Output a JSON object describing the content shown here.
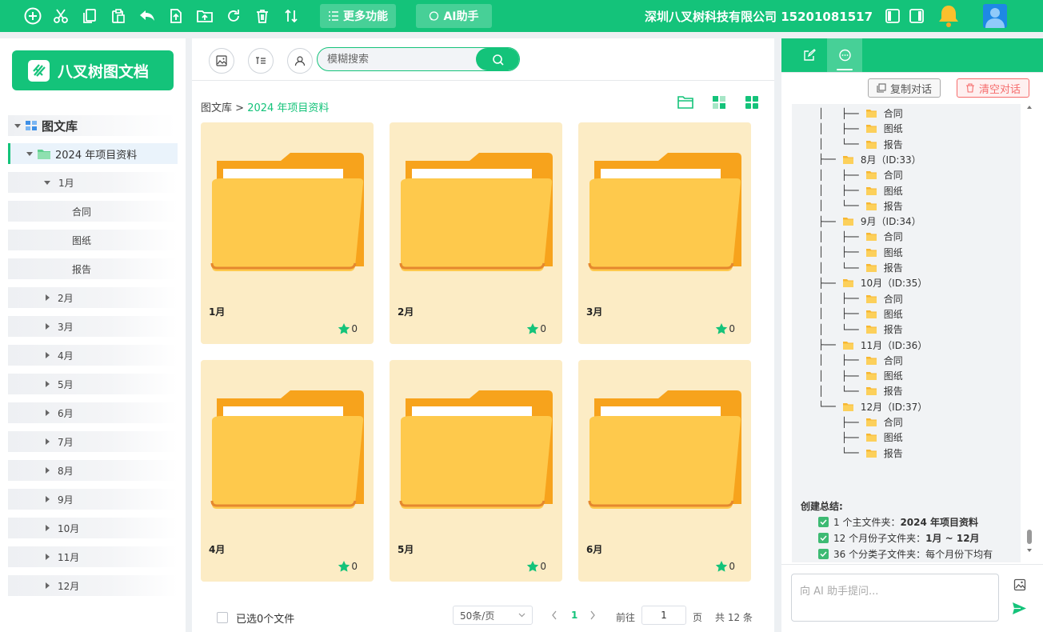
{
  "toolbar": {
    "more_label": "更多功能",
    "ai_label": "AI助手",
    "company": "深圳八叉树科技有限公司 15201081517"
  },
  "sidebar": {
    "logo_text": "八叉树图文档",
    "root_label": "图文库",
    "project_label": "2024 年项目资料",
    "expanded_month": "1月",
    "sub_items": [
      "合同",
      "图纸",
      "报告"
    ],
    "months": [
      "2月",
      "3月",
      "4月",
      "5月",
      "6月",
      "7月",
      "8月",
      "9月",
      "10月",
      "11月",
      "12月"
    ]
  },
  "main": {
    "search_placeholder": "模糊搜索",
    "breadcrumb_root": "图文库",
    "breadcrumb_sep": ">",
    "breadcrumb_current": "2024 年项目资料",
    "folders": [
      {
        "name": "1月",
        "stars": "0"
      },
      {
        "name": "2月",
        "stars": "0"
      },
      {
        "name": "3月",
        "stars": "0"
      },
      {
        "name": "4月",
        "stars": "0"
      },
      {
        "name": "5月",
        "stars": "0"
      },
      {
        "name": "6月",
        "stars": "0"
      }
    ],
    "footer": {
      "selected": "已选0个文件",
      "page_size": "50条/页",
      "current_page": "1",
      "goto_prefix": "前往",
      "goto_value": "1",
      "goto_suffix": "页",
      "total": "共 12 条"
    }
  },
  "assistant": {
    "copy_label": "复制对话",
    "clear_label": "清空对话",
    "tree_lines": [
      {
        "prefix": "│   ├── ",
        "folder": true,
        "text": "合同"
      },
      {
        "prefix": "│   ├── ",
        "folder": true,
        "text": "图纸"
      },
      {
        "prefix": "│   └── ",
        "folder": true,
        "text": "报告"
      },
      {
        "prefix": "├── ",
        "folder": true,
        "text": "8月（ID:33）"
      },
      {
        "prefix": "│   ├── ",
        "folder": true,
        "text": "合同"
      },
      {
        "prefix": "│   ├── ",
        "folder": true,
        "text": "图纸"
      },
      {
        "prefix": "│   └── ",
        "folder": true,
        "text": "报告"
      },
      {
        "prefix": "├── ",
        "folder": true,
        "text": "9月（ID:34）"
      },
      {
        "prefix": "│   ├── ",
        "folder": true,
        "text": "合同"
      },
      {
        "prefix": "│   ├── ",
        "folder": true,
        "text": "图纸"
      },
      {
        "prefix": "│   └── ",
        "folder": true,
        "text": "报告"
      },
      {
        "prefix": "├── ",
        "folder": true,
        "text": "10月（ID:35）"
      },
      {
        "prefix": "│   ├── ",
        "folder": true,
        "text": "合同"
      },
      {
        "prefix": "│   ├── ",
        "folder": true,
        "text": "图纸"
      },
      {
        "prefix": "│   └── ",
        "folder": true,
        "text": "报告"
      },
      {
        "prefix": "├── ",
        "folder": true,
        "text": "11月（ID:36）"
      },
      {
        "prefix": "│   ├── ",
        "folder": true,
        "text": "合同"
      },
      {
        "prefix": "│   ├── ",
        "folder": true,
        "text": "图纸"
      },
      {
        "prefix": "│   └── ",
        "folder": true,
        "text": "报告"
      },
      {
        "prefix": "└── ",
        "folder": true,
        "text": "12月（ID:37）"
      },
      {
        "prefix": "    ├── ",
        "folder": true,
        "text": "合同"
      },
      {
        "prefix": "    ├── ",
        "folder": true,
        "text": "图纸"
      },
      {
        "prefix": "    └── ",
        "folder": true,
        "text": "报告"
      }
    ],
    "summary_title": "创建总结:",
    "summary": [
      {
        "label": "1 个主文件夹：",
        "value": "2024 年项目资料"
      },
      {
        "label": "12 个月份子文件夹：",
        "value": "1月 ~ 12月"
      },
      {
        "label": "36 个分类子文件夹：",
        "value": "每个月份下均有"
      }
    ],
    "input_placeholder": "向 AI 助手提问..."
  },
  "colors": {
    "brand": "#14c37a",
    "folder_card_bg": "#fcecc5",
    "danger": "#f56c6c"
  }
}
